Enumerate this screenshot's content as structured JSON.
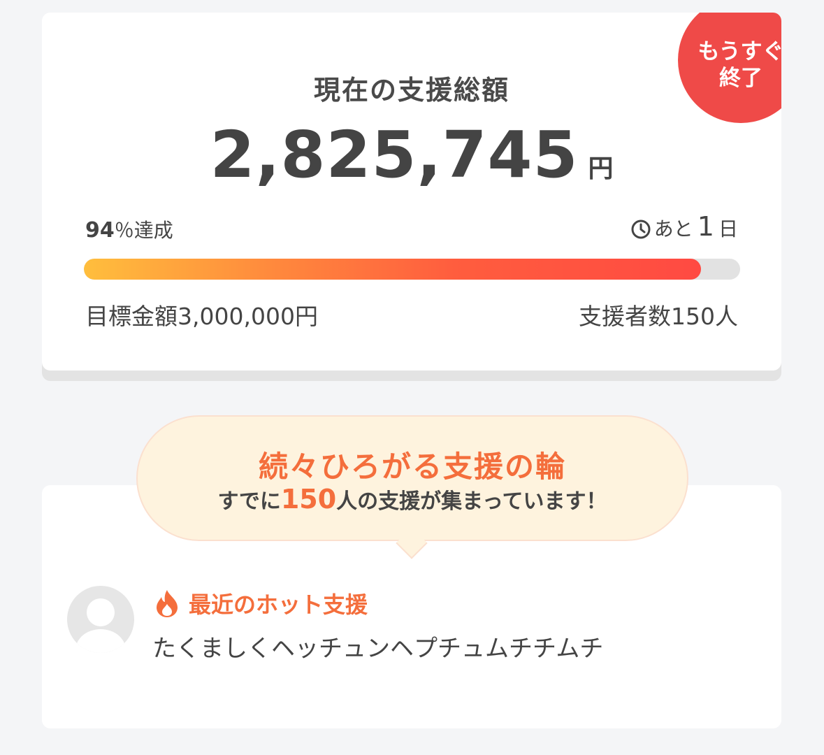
{
  "funding": {
    "title": "現在の支援総額",
    "amount": "2,825,745",
    "amount_unit": "円",
    "badge": "もうすぐ終了",
    "achievement_number": "94",
    "achievement_suffix": "％達成",
    "achievement_fraction": 0.94,
    "remaining_prefix": "あと",
    "remaining_days": "1",
    "remaining_unit": "日",
    "goal_text": "目標金額3,000,000円",
    "backers_text": "支援者数150人",
    "colors": {
      "badge": "#ef4a48",
      "bar_start": "#ffbe3d",
      "bar_end": "#ff4a42"
    }
  },
  "support_wave": {
    "title": "続々ひろがる支援の輪",
    "sub_before": "すでに",
    "sub_number": "150",
    "sub_after": "人の支援が集まっています！",
    "accent": "#f46e3c"
  },
  "hot_support": {
    "label": "最近のホット支援",
    "icon": "flame-icon",
    "name": "たくましくヘッチュンヘプチュムチチムチ",
    "avatar_icon": "default-user-avatar"
  }
}
